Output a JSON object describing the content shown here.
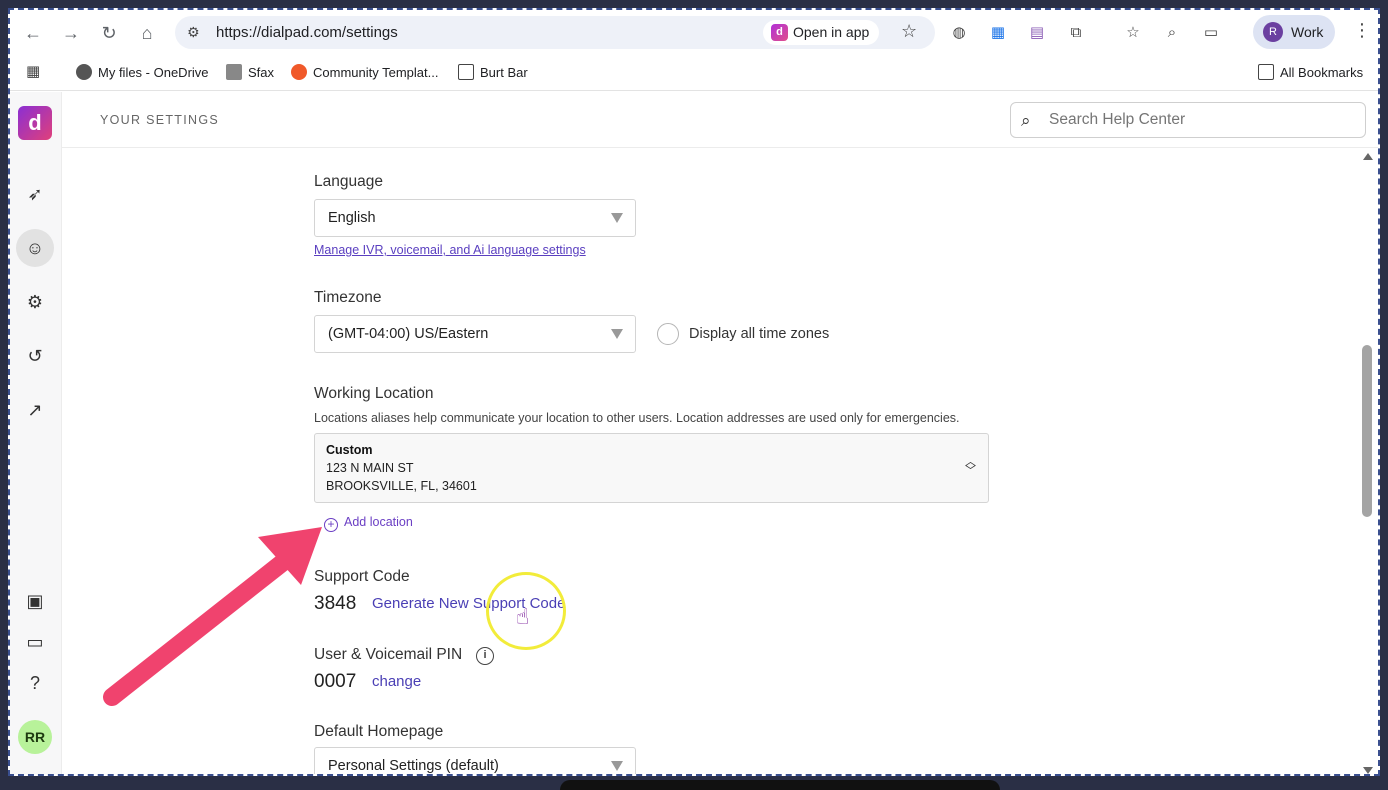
{
  "browser": {
    "url": "https://dialpad.com/settings",
    "open_in_app": "Open in app",
    "profile_initial": "R",
    "profile_label": "Work",
    "bookmarks": [
      {
        "label": "My files - OneDrive"
      },
      {
        "label": "Sfax"
      },
      {
        "label": "Community Templat..."
      },
      {
        "label": "Burt Bar"
      }
    ],
    "all_bookmarks": "All Bookmarks"
  },
  "app": {
    "page_title": "YOUR SETTINGS",
    "search_placeholder": "Search Help Center",
    "user_initials": "RR",
    "brand_color": "#8b2fd3"
  },
  "settings": {
    "language": {
      "label": "Language",
      "value": "English",
      "manage_link": "Manage IVR, voicemail, and Ai language settings"
    },
    "timezone": {
      "label": "Timezone",
      "value": "(GMT-04:00) US/Eastern",
      "display_all": "Display all time zones"
    },
    "working_location": {
      "label": "Working Location",
      "description": "Locations aliases help communicate your location to other users. Location addresses are used only for emergencies.",
      "name": "Custom",
      "address_line1": "123 N MAIN ST",
      "address_line2": "BROOKSVILLE, FL, 34601",
      "add_location": "Add location"
    },
    "support_code": {
      "label": "Support Code",
      "value": "3848",
      "generate": "Generate New Support Code"
    },
    "pin": {
      "label": "User & Voicemail PIN",
      "value": "0007",
      "change": "change"
    },
    "homepage": {
      "label": "Default Homepage",
      "value": "Personal Settings (default)"
    }
  }
}
